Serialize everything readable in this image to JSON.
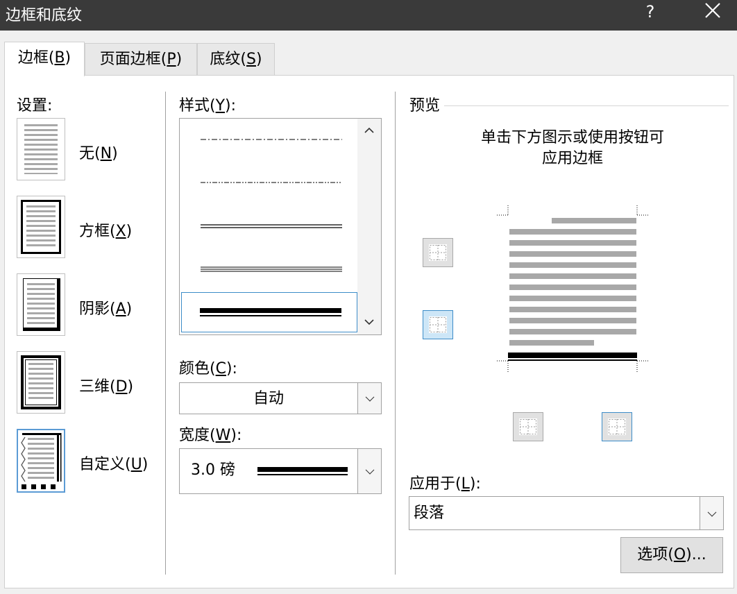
{
  "window": {
    "title": "边框和底纹",
    "help": "?"
  },
  "tabs": [
    {
      "label": "边框(",
      "key": "B",
      "suffix": ")"
    },
    {
      "label": "页面边框(",
      "key": "P",
      "suffix": ")"
    },
    {
      "label": "底纹(",
      "key": "S",
      "suffix": ")"
    }
  ],
  "settings": {
    "label": "设置:",
    "items": [
      {
        "label": "无(",
        "key": "N",
        "suffix": ")"
      },
      {
        "label": "方框(",
        "key": "X",
        "suffix": ")"
      },
      {
        "label": "阴影(",
        "key": "A",
        "suffix": ")"
      },
      {
        "label": "三维(",
        "key": "D",
        "suffix": ")"
      },
      {
        "label": "自定义(",
        "key": "U",
        "suffix": ")"
      }
    ]
  },
  "style": {
    "label": "样式(",
    "key": "Y",
    "suffix": "):"
  },
  "color": {
    "label": "颜色(",
    "key": "C",
    "suffix": "):",
    "value": "自动"
  },
  "width": {
    "label": "宽度(",
    "key": "W",
    "suffix": "):",
    "value": "3.0 磅"
  },
  "preview": {
    "label": "预览",
    "hint_line1": "单击下方图示或使用按钮可",
    "hint_line2": "应用边框"
  },
  "apply_to": {
    "label": "应用于(",
    "key": "L",
    "suffix": "):",
    "value": "段落"
  },
  "options_button": {
    "label": "选项(",
    "key": "O",
    "suffix": ")..."
  }
}
